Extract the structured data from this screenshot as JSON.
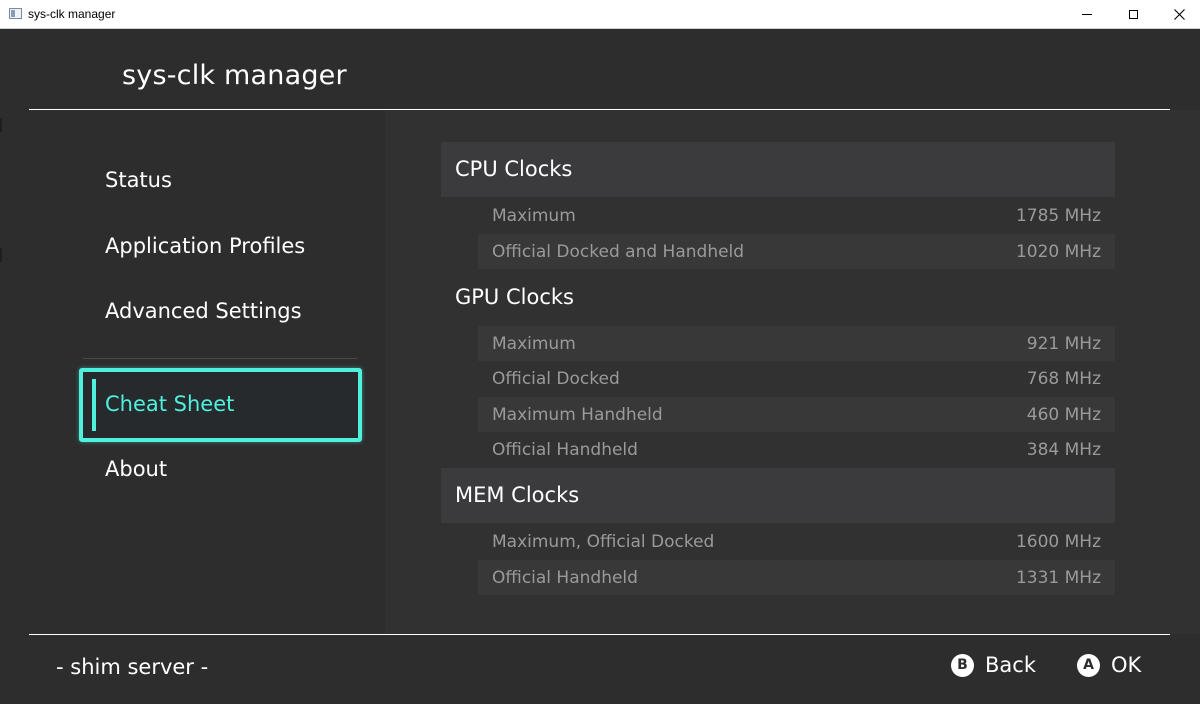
{
  "window": {
    "title": "sys-clk manager",
    "icon": "app-icon",
    "controls": {
      "minimize": "minimize-icon",
      "maximize": "maximize-icon",
      "close": "close-icon"
    }
  },
  "app": {
    "title": "sys-clk manager"
  },
  "sidebar": {
    "items": [
      {
        "label": "Status"
      },
      {
        "label": "Application Profiles"
      },
      {
        "label": "Advanced Settings"
      },
      {
        "label": "Cheat Sheet",
        "selected": true
      },
      {
        "label": "About"
      }
    ]
  },
  "cheatsheet": {
    "sections": [
      {
        "title": "CPU Clocks",
        "rows": [
          {
            "label": "Maximum",
            "value": "1785 MHz"
          },
          {
            "label": "Official Docked and Handheld",
            "value": "1020 MHz"
          }
        ]
      },
      {
        "title": "GPU Clocks",
        "rows": [
          {
            "label": "Maximum",
            "value": "921 MHz"
          },
          {
            "label": "Official Docked",
            "value": "768 MHz"
          },
          {
            "label": "Maximum Handheld",
            "value": "460 MHz"
          },
          {
            "label": "Official Handheld",
            "value": "384 MHz"
          }
        ]
      },
      {
        "title": "MEM Clocks",
        "rows": [
          {
            "label": "Maximum, Official Docked",
            "value": "1600 MHz"
          },
          {
            "label": "Official Handheld",
            "value": "1331 MHz"
          }
        ]
      }
    ]
  },
  "footer": {
    "left_text": "- shim server -",
    "actions": [
      {
        "glyph": "B",
        "label": "Back"
      },
      {
        "glyph": "A",
        "label": "OK"
      }
    ]
  },
  "colors": {
    "background": "#2d2d2d",
    "content_panel": "#313131",
    "accent": "#4ff0dd",
    "text": "#ffffff",
    "muted_text": "#9a9a9a"
  }
}
